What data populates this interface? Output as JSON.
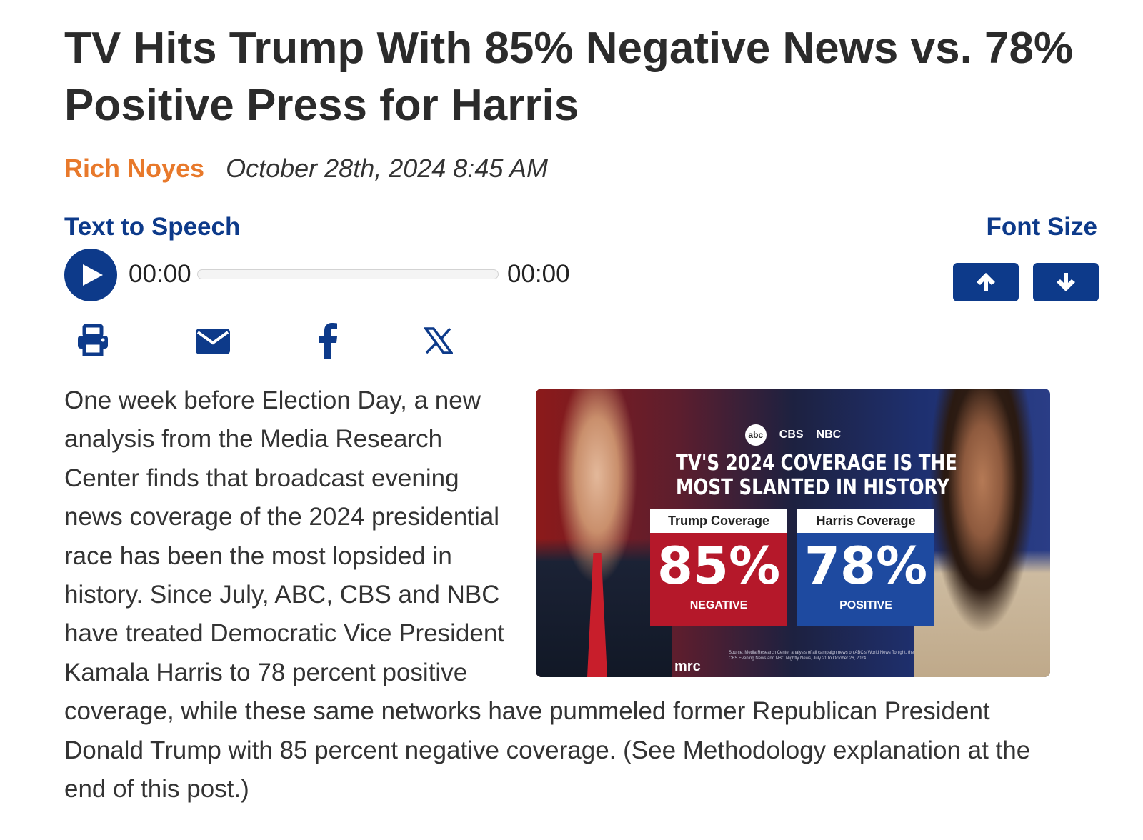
{
  "article": {
    "title": "TV Hits Trump With 85% Negative News vs. 78% Positive Press for Harris",
    "author": "Rich Noyes",
    "date": "October 28th, 2024 8:45 AM"
  },
  "text_to_speech": {
    "label": "Text to Speech",
    "current_time": "00:00",
    "duration": "00:00",
    "progress": 0
  },
  "font_size": {
    "label": "Font Size"
  },
  "share": {
    "icons": [
      "print-icon",
      "email-icon",
      "facebook-icon",
      "x-icon"
    ]
  },
  "figure": {
    "networks": [
      "abc",
      "CBS",
      "NBC"
    ],
    "headline_line1": "TV'S 2024 COVERAGE IS THE",
    "headline_line2": "MOST SLANTED IN HISTORY",
    "trump_caption": "Trump Coverage",
    "trump_value": "85%",
    "trump_label": "NEGATIVE",
    "harris_caption": "Harris Coverage",
    "harris_value": "78%",
    "harris_label": "POSITIVE",
    "brand": "mrc",
    "source": "Source: Media Research Center analysis of all campaign news on ABC's World News Tonight, the CBS Evening News and NBC Nightly News, July 21 to October 26, 2024."
  },
  "body": {
    "paragraph": "One week before Election Day, a new analysis from the Media Research Center finds that broadcast evening news coverage of the 2024 presidential race has been the most lopsided in history. Since July, ABC, CBS and NBC have treated Democratic Vice President Kamala Harris to 78 percent positive coverage, while these same networks have pummeled former Republican President Donald Trump with 85 percent negative coverage. (See Methodology explanation at the end of this post.)"
  },
  "colors": {
    "brand_blue": "#0d3a8a",
    "author_orange": "#e8792b"
  }
}
